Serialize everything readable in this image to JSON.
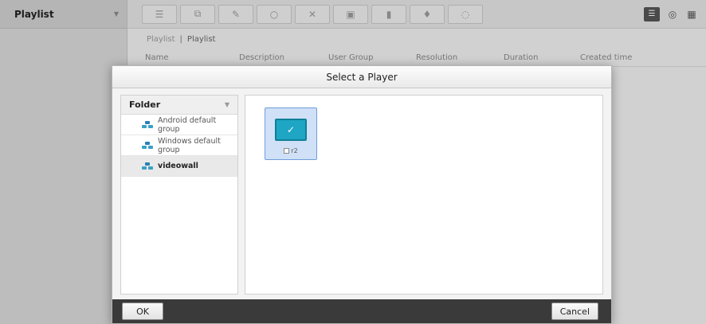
{
  "sidebar": {
    "title": "Playlist"
  },
  "breadcrumb": {
    "root": "Playlist",
    "current": "Playlist"
  },
  "table": {
    "columns": [
      "Name",
      "Description",
      "User Group",
      "Resolution",
      "Duration",
      "Created time"
    ]
  },
  "dialog": {
    "title": "Select a Player",
    "folder_title": "Folder",
    "folders": [
      {
        "label": "Android default group"
      },
      {
        "label": "Windows default group"
      },
      {
        "label": "videowall"
      }
    ],
    "player": {
      "label": "r2"
    },
    "ok_label": "OK",
    "cancel_label": "Cancel"
  }
}
